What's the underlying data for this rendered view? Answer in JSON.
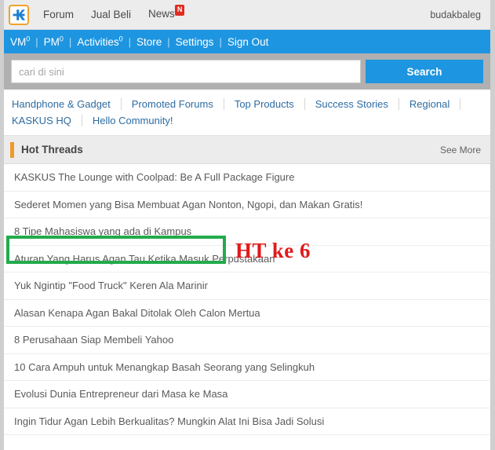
{
  "header": {
    "logo_alt": "KASKUS",
    "nav": [
      {
        "label": "Forum",
        "badge": null
      },
      {
        "label": "Jual Beli",
        "badge": null
      },
      {
        "label": "News",
        "badge": "N"
      }
    ],
    "username": "budakbaleg"
  },
  "bluebar": {
    "items": [
      {
        "label": "VM",
        "sup": "0"
      },
      {
        "label": "PM",
        "sup": "0"
      },
      {
        "label": "Activities",
        "sup": "0"
      },
      {
        "label": "Store",
        "sup": ""
      },
      {
        "label": "Settings",
        "sup": ""
      },
      {
        "label": "Sign Out",
        "sup": ""
      }
    ],
    "separator": "|"
  },
  "search": {
    "placeholder": "cari di sini",
    "value": "",
    "button_label": "Search"
  },
  "category_links": [
    "Handphone & Gadget",
    "Promoted Forums",
    "Top Products",
    "Success Stories",
    "Regional",
    "KASKUS HQ",
    "Hello Community!"
  ],
  "hot_threads": {
    "title": "Hot Threads",
    "see_more_label": "See More",
    "threads": [
      "KASKUS The Lounge with Coolpad: Be A Full Package Figure",
      "Sederet Momen yang Bisa Membuat Agan Nonton, Ngopi, dan Makan Gratis!",
      "8 Tipe Mahasiswa yang ada di Kampus",
      "Aturan Yang Harus Agan Tau Ketika Masuk Perpustakaan",
      "Yuk Ngintip \"Food Truck\" Keren Ala Marinir",
      "Alasan Kenapa Agan Bakal Ditolak Oleh Calon Mertua",
      "8 Perusahaan Siap Membeli Yahoo",
      "10 Cara Ampuh untuk Menangkap Basah Seorang yang Selingkuh",
      "Evolusi Dunia Entrepreneur dari Masa ke Masa",
      "Ingin Tidur Agan Lebih Berkualitas? Mungkin Alat Ini Bisa Jadi Solusi"
    ]
  },
  "annotation": {
    "text": "HT ke 6",
    "box_color": "#22ab4b",
    "text_color": "#e01b1b"
  },
  "colors": {
    "brand_blue": "#1e95e0",
    "accent_orange": "#f0992b",
    "link_blue": "#2d6ca2",
    "badge_red": "#e02b20"
  }
}
